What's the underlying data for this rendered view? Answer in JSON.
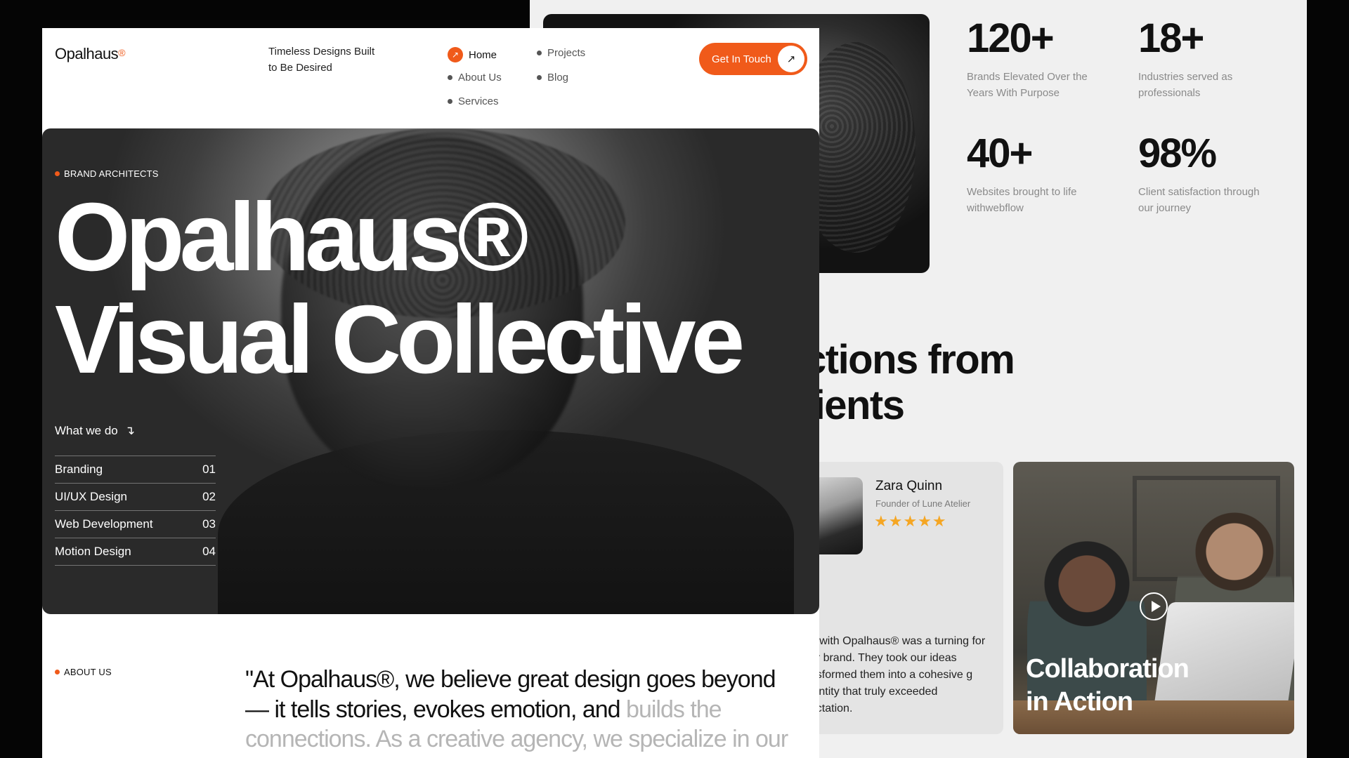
{
  "brand": {
    "name": "Opalhaus",
    "mark": "®",
    "accent": "#f05a1a"
  },
  "header": {
    "tagline_line1": "Timeless Designs Built",
    "tagline_line2": "to Be Desired",
    "nav": [
      {
        "label": "Home",
        "active": true
      },
      {
        "label": "About Us",
        "active": false
      },
      {
        "label": "Services",
        "active": false
      },
      {
        "label": "Projects",
        "active": false
      },
      {
        "label": "Blog",
        "active": false
      }
    ],
    "cta_label": "Get In Touch",
    "cta_icon": "arrow-up-right-icon"
  },
  "hero": {
    "eyebrow": "BRAND ARCHITECTS",
    "title_line1": "Opalhaus®",
    "title_line2": "Visual Collective",
    "services_heading": "What we do",
    "services_icon": "arrow-down-icon",
    "services": [
      {
        "name": "Branding",
        "num": "01"
      },
      {
        "name": "UI/UX Design",
        "num": "02"
      },
      {
        "name": "Web Development",
        "num": "03"
      },
      {
        "name": "Motion Design",
        "num": "04"
      }
    ]
  },
  "about": {
    "eyebrow": "ABOUT US",
    "quote_dark": "\"At Opalhaus®, we believe great design goes beyond — it tells stories, evokes emotion, and ",
    "quote_muted": "builds the connections. As a creative agency, we specialize in our"
  },
  "stats": [
    {
      "value": "120+",
      "desc": "Brands Elevated Over the Years With Purpose"
    },
    {
      "value": "18+",
      "desc": "Industries served as professionals"
    },
    {
      "value": "40+",
      "desc": "Websites brought to life withwebflow"
    },
    {
      "value": "98%",
      "desc": "Client satisfaction through our journey"
    }
  ],
  "testimonials": {
    "title_line1": "ctions from",
    "title_line2": "lients",
    "review": {
      "name": "Zara Quinn",
      "role": "Founder of Lune Atelier",
      "stars": "★★★★★",
      "rating": 5,
      "text": "ng with Opalhaus® was a turning for our brand. They took our ideas ansformed them into a cohesive g identity that truly exceeded pectation."
    },
    "video": {
      "title_line1": "Collaboration",
      "title_line2": "in Action",
      "icon": "play-icon"
    }
  }
}
